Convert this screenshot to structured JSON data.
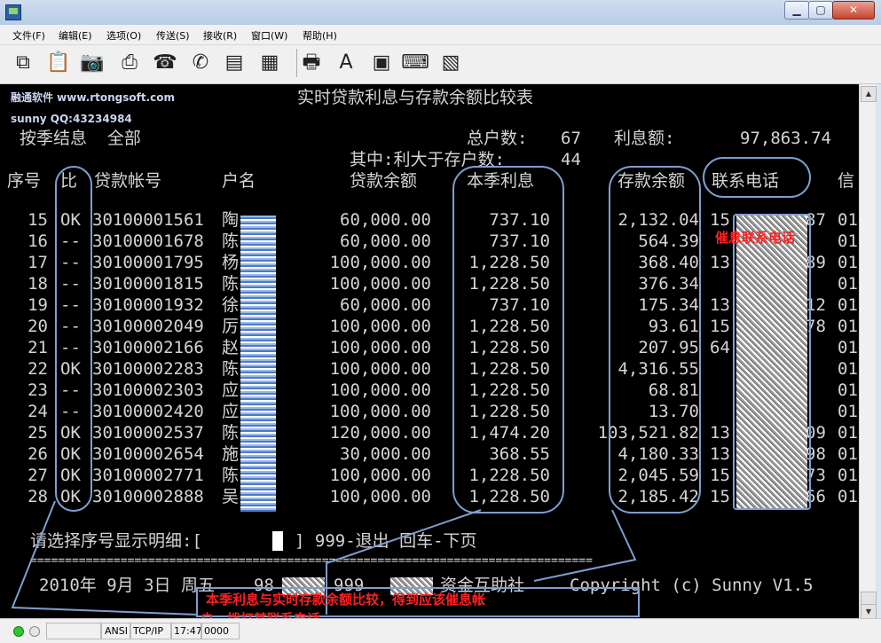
{
  "window": {
    "title": ""
  },
  "menu": [
    "文件(F)",
    "编辑(E)",
    "选项(O)",
    "传送(S)",
    "接收(R)",
    "窗口(W)",
    "帮助(H)"
  ],
  "toolbar_icons": [
    "copy-icon",
    "paste-icon",
    "camera-icon",
    "printer-icon",
    "phone-connect-icon",
    "phone-hangup-icon",
    "receive-file-icon",
    "send-file-icon",
    "print-screen-icon",
    "font-icon",
    "terminal-icon",
    "keyboard-icon",
    "capture-icon"
  ],
  "terminal": {
    "brand": "融通软件 www.rtongsoft.com",
    "qq": "sunny QQ:43234984",
    "report_title": "实时贷款利息与存款余额比较表",
    "mode": "按季结息  全部",
    "total_label": "总户数:",
    "total_value": "67",
    "interest_label": "利息额:",
    "interest_value": "97,863.74",
    "sub_label": "其中:利大于存户数:",
    "sub_value": "44",
    "headers": {
      "seq": "序号",
      "cmp": "比",
      "account": "贷款帐号",
      "name": "户名",
      "balance": "贷款余额",
      "interest": "本季利息",
      "deposit": "存款余额",
      "phone": "联系电话",
      "extra": "信"
    },
    "rows": [
      {
        "seq": "15",
        "cmp": "OK",
        "account": "30100001561",
        "name": "陶",
        "balance": "60,000.00",
        "interest": "737.10",
        "deposit": "2,132.04",
        "phone": "15",
        "phone_end": "87",
        "extra": "01"
      },
      {
        "seq": "16",
        "cmp": "--",
        "account": "30100001678",
        "name": "陈",
        "balance": "60,000.00",
        "interest": "737.10",
        "deposit": "564.39",
        "phone": "",
        "phone_end": "",
        "extra": "01"
      },
      {
        "seq": "17",
        "cmp": "--",
        "account": "30100001795",
        "name": "杨",
        "balance": "100,000.00",
        "interest": "1,228.50",
        "deposit": "368.40",
        "phone": "13",
        "phone_end": "89",
        "extra": "01"
      },
      {
        "seq": "18",
        "cmp": "--",
        "account": "30100001815",
        "name": "陈",
        "balance": "100,000.00",
        "interest": "1,228.50",
        "deposit": "376.34",
        "phone": "",
        "phone_end": "",
        "extra": "01"
      },
      {
        "seq": "19",
        "cmp": "--",
        "account": "30100001932",
        "name": "徐",
        "balance": "60,000.00",
        "interest": "737.10",
        "deposit": "175.34",
        "phone": "13",
        "phone_end": "12",
        "extra": "01"
      },
      {
        "seq": "20",
        "cmp": "--",
        "account": "30100002049",
        "name": "厉",
        "balance": "100,000.00",
        "interest": "1,228.50",
        "deposit": "93.61",
        "phone": "15",
        "phone_end": "78",
        "extra": "01"
      },
      {
        "seq": "21",
        "cmp": "--",
        "account": "30100002166",
        "name": "赵",
        "balance": "100,000.00",
        "interest": "1,228.50",
        "deposit": "207.95",
        "phone": "64",
        "phone_end": "",
        "extra": "01"
      },
      {
        "seq": "22",
        "cmp": "OK",
        "account": "30100002283",
        "name": "陈",
        "balance": "100,000.00",
        "interest": "1,228.50",
        "deposit": "4,316.55",
        "phone": "",
        "phone_end": "",
        "extra": "01"
      },
      {
        "seq": "23",
        "cmp": "--",
        "account": "30100002303",
        "name": "应",
        "balance": "100,000.00",
        "interest": "1,228.50",
        "deposit": "68.81",
        "phone": "",
        "phone_end": "",
        "extra": "01"
      },
      {
        "seq": "24",
        "cmp": "--",
        "account": "30100002420",
        "name": "应",
        "balance": "100,000.00",
        "interest": "1,228.50",
        "deposit": "13.70",
        "phone": "",
        "phone_end": "",
        "extra": "01"
      },
      {
        "seq": "25",
        "cmp": "OK",
        "account": "30100002537",
        "name": "陈",
        "balance": "120,000.00",
        "interest": "1,474.20",
        "deposit": "103,521.82",
        "phone": "13",
        "phone_end": "09",
        "extra": "01"
      },
      {
        "seq": "26",
        "cmp": "OK",
        "account": "30100002654",
        "name": "施",
        "balance": "30,000.00",
        "interest": "368.55",
        "deposit": "4,180.33",
        "phone": "13",
        "phone_end": "98",
        "extra": "01"
      },
      {
        "seq": "27",
        "cmp": "OK",
        "account": "30100002771",
        "name": "陈",
        "balance": "100,000.00",
        "interest": "1,228.50",
        "deposit": "2,045.59",
        "phone": "15",
        "phone_end": "73",
        "extra": "01"
      },
      {
        "seq": "28",
        "cmp": "OK",
        "account": "30100002888",
        "name": "吴",
        "balance": "100,000.00",
        "interest": "1,228.50",
        "deposit": "2,185.42",
        "phone": "15",
        "phone_end": "66",
        "extra": "01"
      }
    ],
    "prompt_left": "请选择序号显示明细:[",
    "prompt_right": "] 999-退出 回车-下页",
    "separator": "=================================================================================",
    "footer_date": "2010年 9月 3日 周五",
    "footer_code1": "98",
    "footer_code2": "999",
    "footer_org": "资金互助社",
    "footer_copy": "Copyright (c) Sunny V1.5",
    "callout_phone": "催息联系电话",
    "callout_note_1": "本季利息与实时存款余额比较，得到应该催息帐",
    "callout_note_2": "户，拨打其联系电话。"
  },
  "statusbar": {
    "protocol_enc": "ANSI",
    "protocol": "TCP/IP",
    "time": "17:47",
    "extra": "0000"
  },
  "colors": {
    "terminal_bg": "#000000",
    "terminal_fg": "#d4d4d4",
    "annotation_outline": "#7d9fd0",
    "annotation_text": "#ff2020"
  }
}
